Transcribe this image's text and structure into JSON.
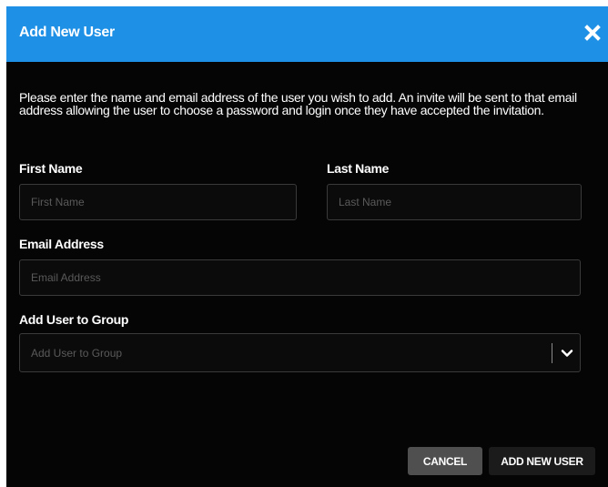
{
  "dialog": {
    "title": "Add New User",
    "intro": "Please enter the name and email address of the user you wish to add. An invite will be sent to that email address allowing the user to choose a password and login once they have accepted the invitation."
  },
  "form": {
    "first_name": {
      "label": "First Name",
      "placeholder": "First Name",
      "value": ""
    },
    "last_name": {
      "label": "Last Name",
      "placeholder": "Last Name",
      "value": ""
    },
    "email": {
      "label": "Email Address",
      "placeholder": "Email Address",
      "value": ""
    },
    "group": {
      "label": "Add User to Group",
      "placeholder": "Add User to Group"
    }
  },
  "buttons": {
    "cancel": "CANCEL",
    "add": "ADD NEW USER"
  },
  "colors": {
    "header": "#1e90e6",
    "background": "#050505",
    "cancel_button": "#4f4f4f",
    "add_button": "#1b1b1b"
  },
  "icons": {
    "close": "close-icon",
    "dropdown": "chevron-down-icon"
  }
}
